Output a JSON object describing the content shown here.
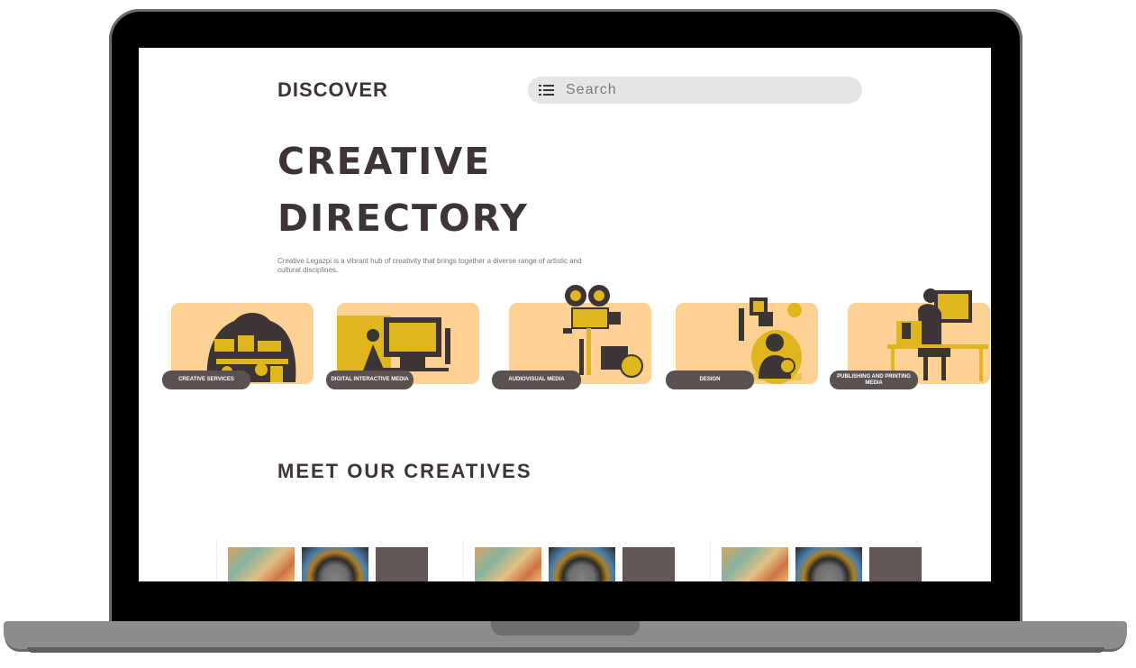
{
  "header": {
    "brand": "DISCOVER",
    "search_placeholder": "Search"
  },
  "hero": {
    "title_line1": "CREATIVE",
    "title_line2": "DIRECTORY",
    "description": "Creative Legazpi is a vibrant hub of creativity that brings together a diverse range of artistic and cultural disciplines."
  },
  "categories": [
    {
      "label": "CREATIVE SERVICES"
    },
    {
      "label": "DIGITAL INTERACTIVE MEDIA"
    },
    {
      "label": "AUDIOVISUAL MEDIA"
    },
    {
      "label": "DESIGN"
    },
    {
      "label": "PUBLISHING AND PRINTING MEDIA"
    }
  ],
  "creatives": {
    "title": "MEET OUR CREATIVES"
  },
  "colors": {
    "card_bg": "#fdd093",
    "dark": "#3d3535",
    "label_bg": "#5a5151",
    "art_yellow": "#e0b61f"
  }
}
